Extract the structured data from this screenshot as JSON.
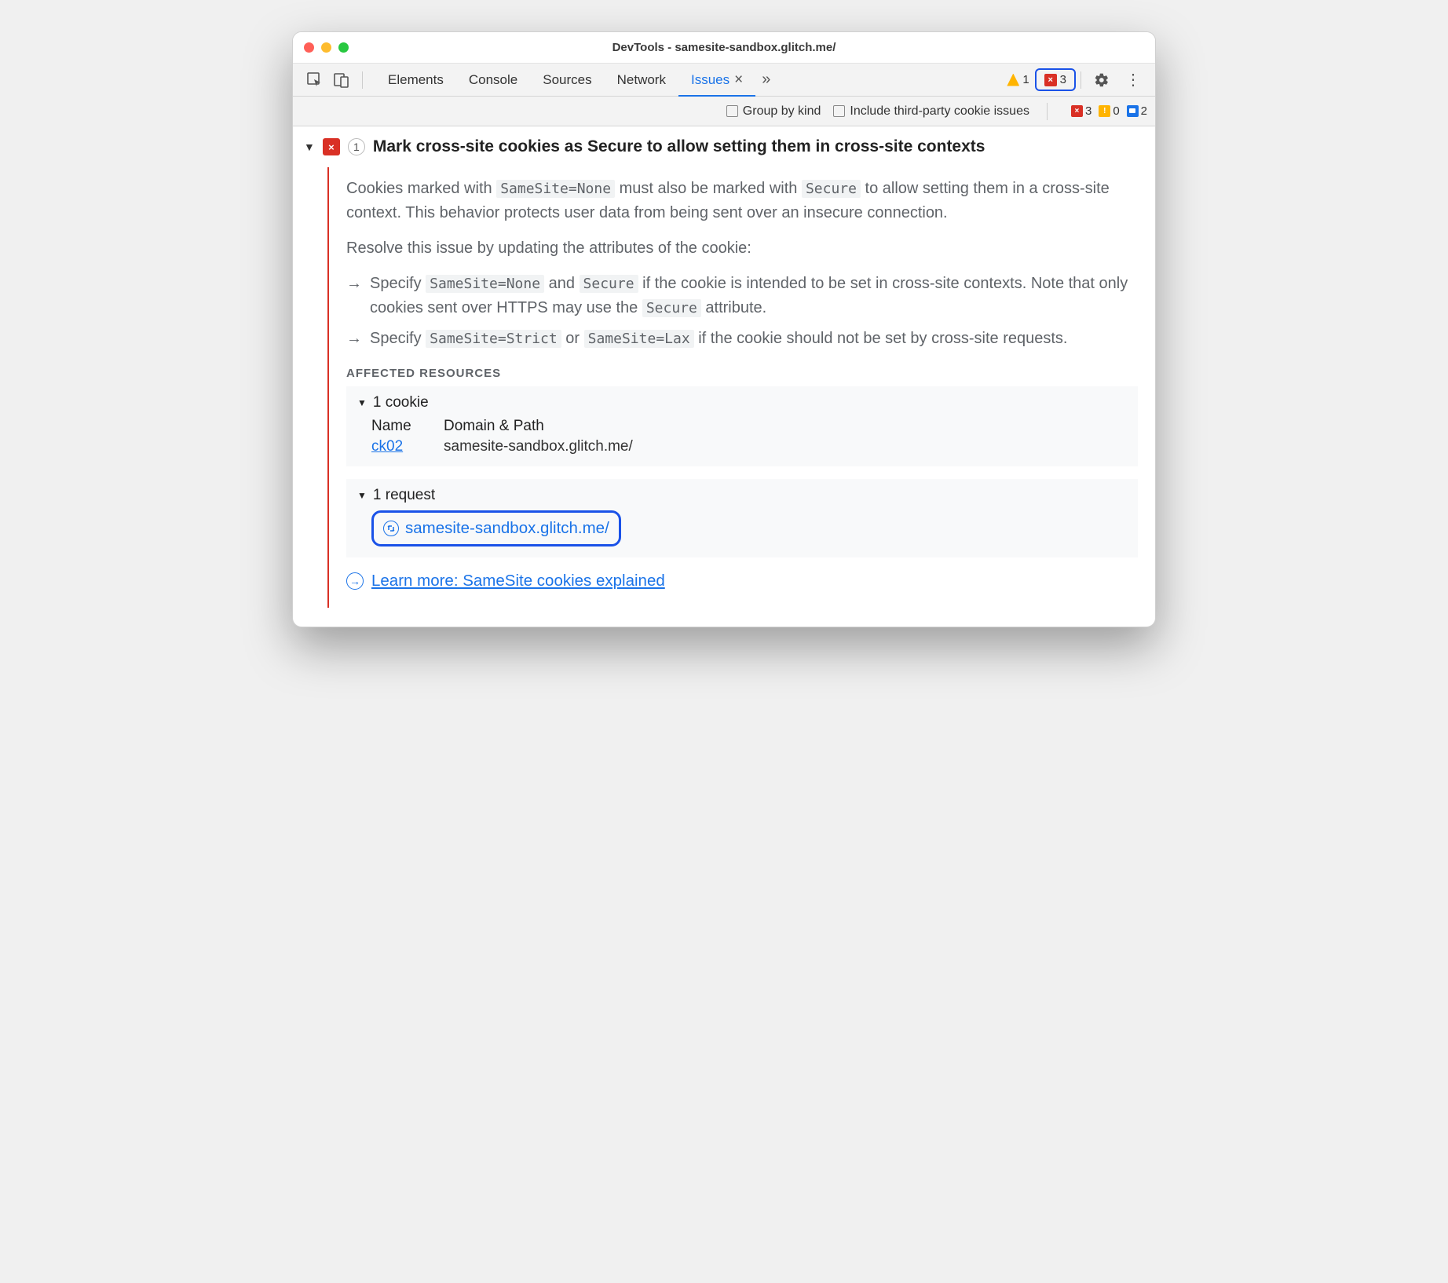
{
  "window": {
    "title": "DevTools - samesite-sandbox.glitch.me/"
  },
  "tabs": {
    "elements": "Elements",
    "console": "Console",
    "sources": "Sources",
    "network": "Network",
    "issues": "Issues"
  },
  "toolbar_counters": {
    "warn": "1",
    "err": "3"
  },
  "subbar": {
    "group": "Group by kind",
    "thirdparty": "Include third-party cookie issues",
    "err": "3",
    "warn": "0",
    "info": "2"
  },
  "issue": {
    "count": "1",
    "title": "Mark cross-site cookies as Secure to allow setting them in cross-site contexts",
    "p1a": "Cookies marked with ",
    "p1b": " must also be marked with ",
    "p1c": " to allow setting them in a cross-site context. This behavior protects user data from being sent over an insecure connection.",
    "p2": "Resolve this issue by updating the attributes of the cookie:",
    "li1a": "Specify ",
    "li1b": " and ",
    "li1c": " if the cookie is intended to be set in cross-site contexts. Note that only cookies sent over HTTPS may use the ",
    "li1d": " attribute.",
    "li2a": "Specify ",
    "li2b": " or ",
    "li2c": " if the cookie should not be set by cross-site requests.",
    "code_none": "SameSite=None",
    "code_secure": "Secure",
    "code_strict": "SameSite=Strict",
    "code_lax": "SameSite=Lax",
    "affected_label": "AFFECTED RESOURCES",
    "cookie_header": "1 cookie",
    "th_name": "Name",
    "th_domain": "Domain & Path",
    "cookie_name": "ck02",
    "cookie_domain": "samesite-sandbox.glitch.me/",
    "req_header": "1 request",
    "req_url": "samesite-sandbox.glitch.me/",
    "learn": "Learn more: SameSite cookies explained"
  }
}
